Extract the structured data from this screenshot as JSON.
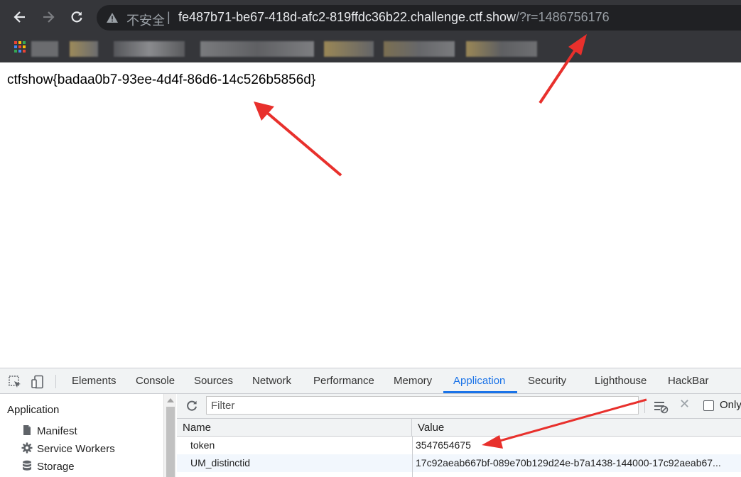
{
  "browser": {
    "nav": {
      "back_icon": "arrow-left-icon",
      "forward_icon": "arrow-right-icon",
      "reload_icon": "reload-icon"
    },
    "address": {
      "security_label": "不安全",
      "separator": "|",
      "host": "fe487b71-be67-418d-afc2-819ffdc36b22.challenge.ctf.show",
      "path": "/?r=1486756176"
    }
  },
  "page": {
    "content": "ctfshow{badaa0b7-93ee-4d4f-86d6-14c526b5856d}"
  },
  "devtools": {
    "tabs": [
      {
        "label": "Elements"
      },
      {
        "label": "Console"
      },
      {
        "label": "Sources"
      },
      {
        "label": "Network"
      },
      {
        "label": "Performance"
      },
      {
        "label": "Memory"
      },
      {
        "label": "Application",
        "active": true
      },
      {
        "label": "Security"
      },
      {
        "label": "Lighthouse"
      },
      {
        "label": "HackBar"
      }
    ],
    "sidebar": {
      "title": "Application",
      "items": [
        {
          "label": "Manifest",
          "icon": "document-icon"
        },
        {
          "label": "Service Workers",
          "icon": "gear-icon"
        },
        {
          "label": "Storage",
          "icon": "database-icon"
        }
      ]
    },
    "toolbar": {
      "filter_placeholder": "Filter",
      "only_label": "Only"
    },
    "table": {
      "columns": [
        "Name",
        "Value"
      ],
      "rows": [
        {
          "name": "token",
          "value": "3547654675"
        },
        {
          "name": "UM_distinctid",
          "value": "17c92aeab667bf-089e70b129d24e-b7a1438-144000-17c92aeab67..."
        }
      ]
    }
  },
  "colors": {
    "chrome_bg": "#35363a",
    "omnibox_bg": "#202124",
    "accent_blue": "#1a73e8",
    "annotation_red": "#e8302c"
  }
}
